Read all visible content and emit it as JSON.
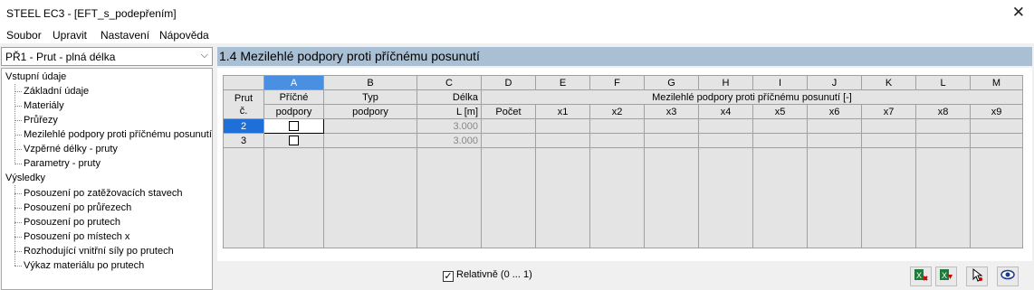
{
  "window": {
    "title": "STEEL EC3 - [EFT_s_podepřením]",
    "close_glyph": "✕"
  },
  "menu": {
    "items": [
      "Soubor",
      "Upravit",
      "Nastavení",
      "Nápověda"
    ]
  },
  "combo": {
    "selected": "PŘ1 - Prut - plná délka",
    "arrow_glyph": "⌵"
  },
  "tree": {
    "input_header": "Vstupní údaje",
    "input_items": [
      "Základní údaje",
      "Materiály",
      "Průřezy",
      "Mezilehlé podpory proti příčnému posunutí",
      "Vzpěrné délky - pruty",
      "Parametry - pruty"
    ],
    "results_header": "Výsledky",
    "results_items": [
      "Posouzení po zatěžovacích stavech",
      "Posouzení po průřezech",
      "Posouzení po prutech",
      "Posouzení po místech x",
      "Rozhodující vnitřní síly po prutech",
      "Výkaz materiálu po prutech"
    ]
  },
  "panel": {
    "title": "1.4 Mezilehlé podpory proti příčnému posunutí"
  },
  "table": {
    "col_letters": [
      "A",
      "B",
      "C",
      "D",
      "E",
      "F",
      "G",
      "H",
      "I",
      "J",
      "K",
      "L",
      "M"
    ],
    "selected_col": "A",
    "h_prut_1": "Prut",
    "h_prut_2": "č.",
    "h_a_1": "Příčné",
    "h_a_2": "podpory",
    "h_b_1": "Typ",
    "h_b_2": "podpory",
    "h_c_1": "Délka",
    "h_c_2": "L [m]",
    "h_group": "Mezilehlé podpory proti příčnému posunutí [-]",
    "h_d": "Počet",
    "h_x": [
      "x1",
      "x2",
      "x3",
      "x4",
      "x5",
      "x6",
      "x7",
      "x8",
      "x9"
    ],
    "rows": [
      {
        "no": "2",
        "length": "3.000",
        "selected": true,
        "supports_checked": false
      },
      {
        "no": "3",
        "length": "3.000",
        "selected": false,
        "supports_checked": false
      }
    ]
  },
  "bottom": {
    "relative_label": "Relativně (0 ... 1)",
    "relative_checked": true,
    "buttons": [
      "import-excel-icon",
      "export-excel-icon",
      "pick-graphically-icon",
      "view-icon"
    ]
  }
}
